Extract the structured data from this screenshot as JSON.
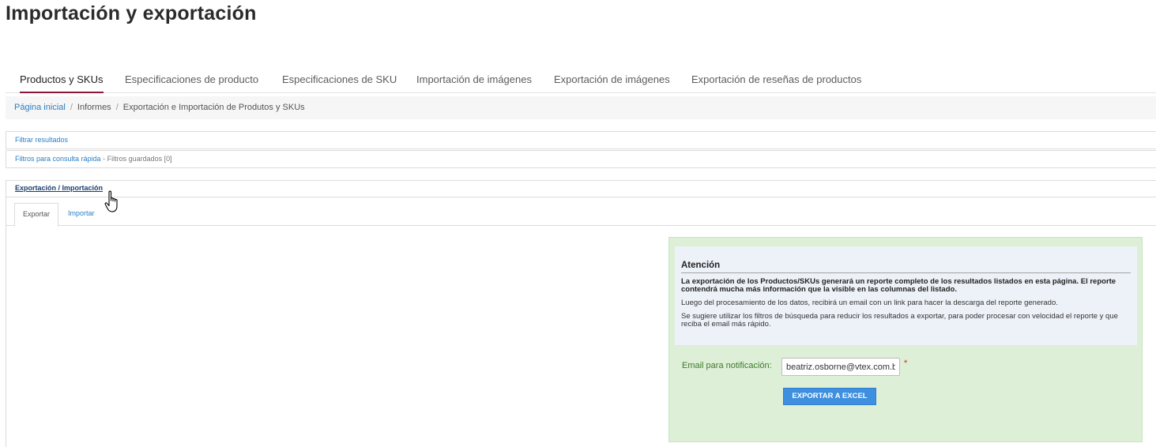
{
  "page": {
    "title": "Importación y exportación"
  },
  "tabs": [
    {
      "label": "Productos y SKUs",
      "active": true
    },
    {
      "label": "Especificaciones de producto"
    },
    {
      "label": "Especificaciones de SKU"
    },
    {
      "label": "Importación de imágenes"
    },
    {
      "label": "Exportación de imágenes"
    },
    {
      "label": "Exportación de reseñas de productos"
    }
  ],
  "breadcrumb": {
    "home": "Página inicial",
    "sep": "/",
    "reports": "Informes",
    "current": "Exportación e Importación de Produtos y SKUs"
  },
  "filters": {
    "filter_results": "Filtrar resultados",
    "quick_filters": "Filtros para consulta rápida",
    "saved_filters": "- Filtros guardados [0]"
  },
  "panel": {
    "header": "Exportación / Importación",
    "tab_export": "Exportar",
    "tab_import": "Importar"
  },
  "notice": {
    "title": "Atención",
    "line1": "La exportación de los Productos/SKUs generará un reporte completo de los resultados listados en esta página. El reporte contendrá mucha más información que la visible en las columnas del listado.",
    "line2": "Luego del procesamiento de los datos, recibirá un email con un link para hacer la descarga del reporte generado.",
    "line3": "Se sugiere utilizar los filtros de búsqueda para reducir los resultados a exportar, para poder procesar con velocidad el reporte y que reciba el email más rápido."
  },
  "form": {
    "email_label": "Email para notificación:",
    "email_value": "beatriz.osborne@vtex.com.br",
    "required_mark": "*",
    "export_button": "EXPORTAR A EXCEL"
  },
  "colors": {
    "active_tab_underline": "#8b1738",
    "link": "#2a7fc5",
    "export_box_bg": "#ddefd7",
    "button_bg": "#3e8fe0"
  },
  "icons": {
    "cursor": "hand-pointer-icon"
  }
}
